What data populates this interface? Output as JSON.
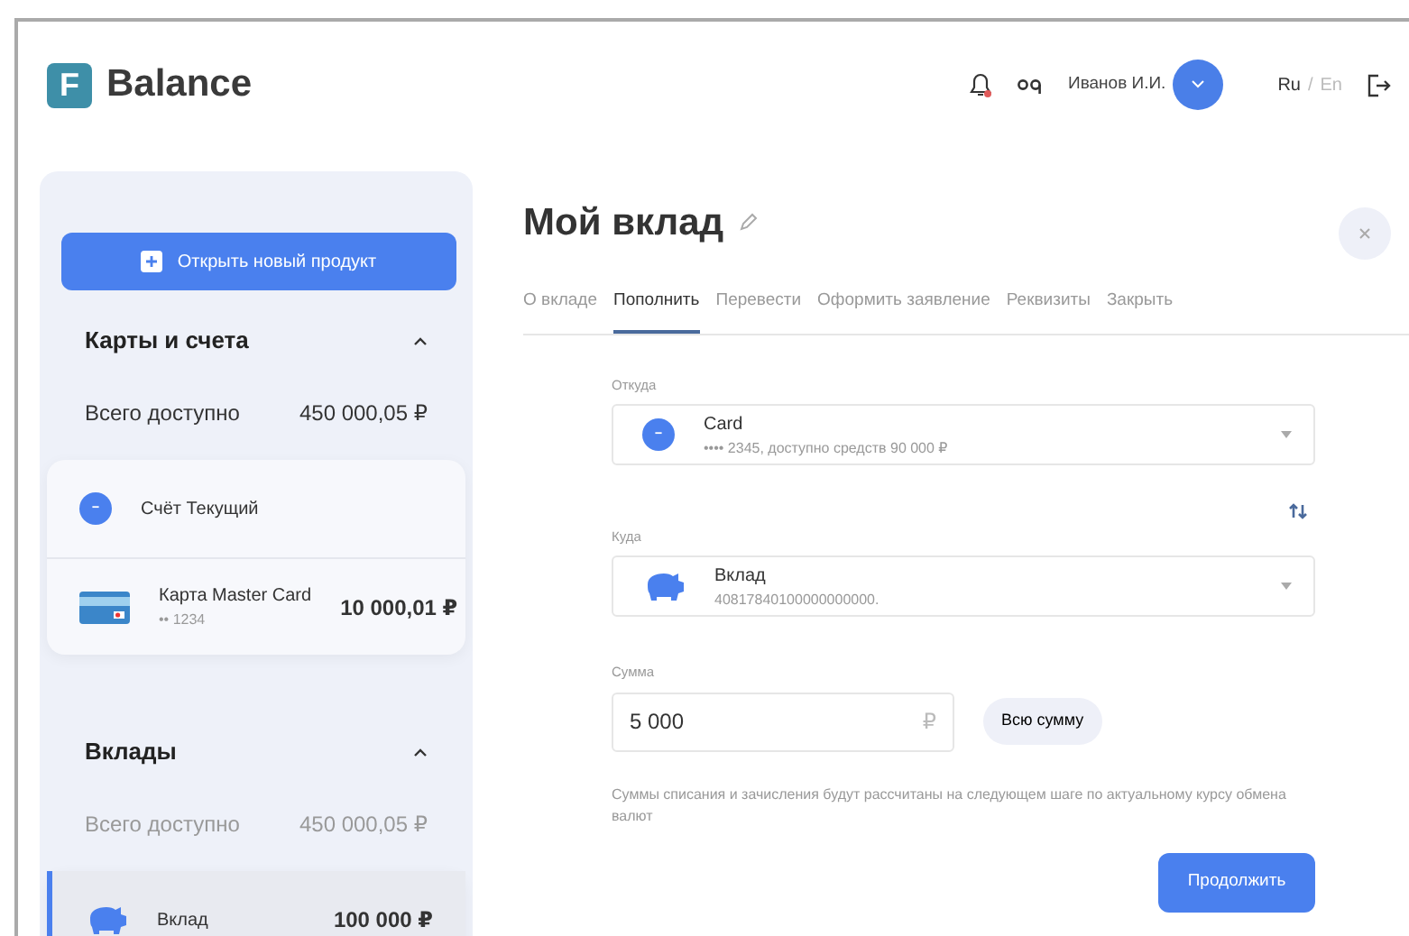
{
  "header": {
    "logo_mark": "F",
    "logo_name": "Balance",
    "notifications_unread": true,
    "user": "Иванов И.И.",
    "languages": [
      {
        "label": "Ru",
        "selected": true
      },
      {
        "label": "En",
        "selected": false
      }
    ],
    "language_separator": "/"
  },
  "sidebar": {
    "open_button": "Открыть новый продукт",
    "sections": [
      {
        "title": "Карты и счета",
        "expanded": true,
        "total_label": "Всего доступно",
        "total_value": "450 000,05 ₽",
        "dimmed": false,
        "items": [
          {
            "kind": "account",
            "name": "Счёт Текущий",
            "selected": false
          },
          {
            "kind": "card",
            "name": "Карта Master Card",
            "number": "•• 1234",
            "amount": "10 000,01 ₽",
            "selected": false
          }
        ]
      },
      {
        "title": "Вклады",
        "expanded": true,
        "total_label": "Всего доступно",
        "total_value": "450 000,05 ₽",
        "dimmed": true,
        "items": [
          {
            "kind": "deposit",
            "name": "Вклад",
            "amount": "100 000 ₽",
            "selected": true
          }
        ]
      }
    ]
  },
  "main": {
    "title": "Мой вклад",
    "tabs": [
      {
        "label": "О вкладе",
        "selected": false
      },
      {
        "label": "Пополнить",
        "selected": true
      },
      {
        "label": "Перевести",
        "selected": false
      },
      {
        "label": "Оформить заявление",
        "selected": false
      },
      {
        "label": "Реквизиты",
        "selected": false
      },
      {
        "label": "Закрыть",
        "selected": false
      }
    ],
    "from": {
      "label": "Откуда",
      "kind": "account",
      "name": "Card",
      "detail": "•••• 2345, доступно средств 90 000 ₽"
    },
    "to": {
      "label": "Куда",
      "kind": "deposit",
      "name": "Вклад",
      "detail": "40817840100000000000."
    },
    "amount": {
      "label": "Сумма",
      "value": "5 000",
      "currency": "₽"
    },
    "all_button": "Всю сумму",
    "note": "Суммы списания и зачисления будут рассчитаны на следующем шаге по актуальному курсу обмена валют",
    "submit": "Продолжить"
  }
}
